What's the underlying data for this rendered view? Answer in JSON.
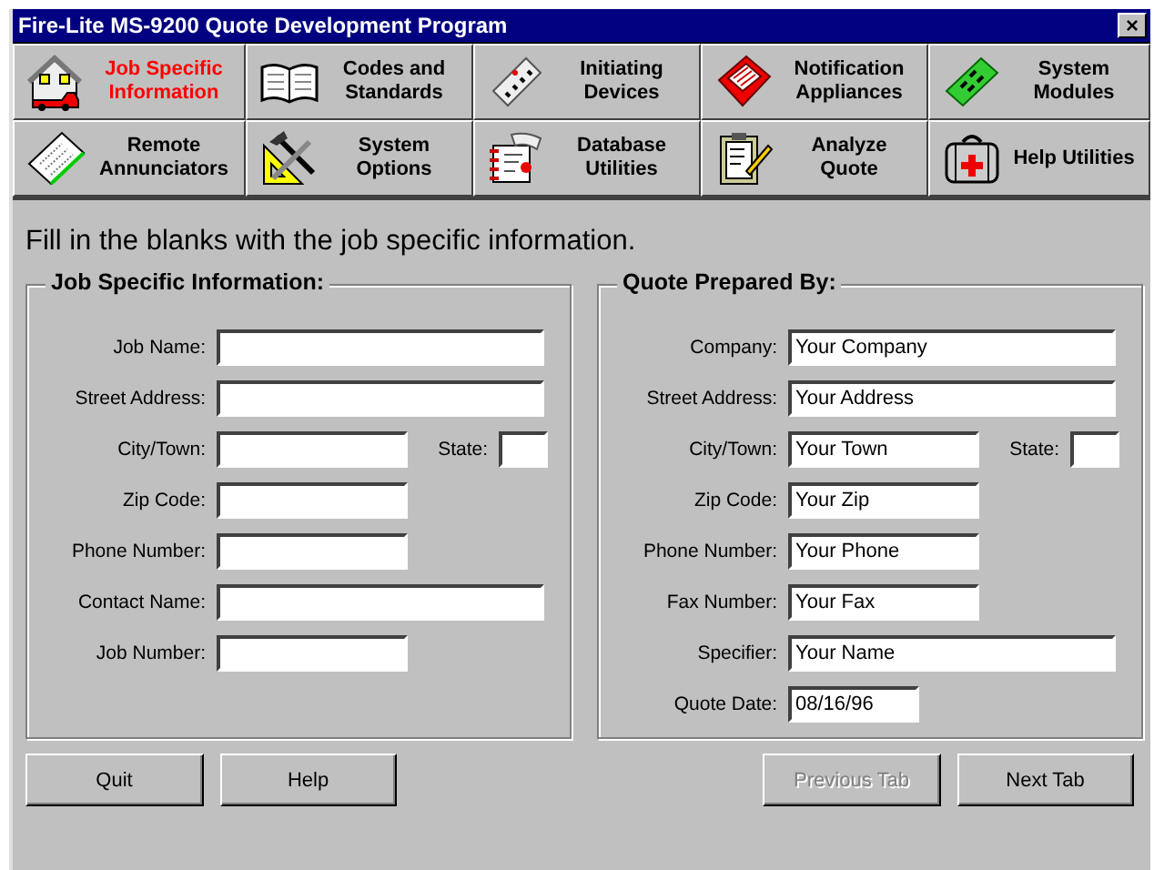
{
  "window": {
    "title": "Fire-Lite MS-9200 Quote Development Program",
    "close": "×"
  },
  "tabs": [
    {
      "label": "Job Specific Information",
      "selected": true
    },
    {
      "label": "Codes and Standards",
      "selected": false
    },
    {
      "label": "Initiating Devices",
      "selected": false
    },
    {
      "label": "Notification Appliances",
      "selected": false
    },
    {
      "label": "System Modules",
      "selected": false
    },
    {
      "label": "Remote Annunciators",
      "selected": false
    },
    {
      "label": "System Options",
      "selected": false
    },
    {
      "label": "Database Utilities",
      "selected": false
    },
    {
      "label": "Analyze Quote",
      "selected": false
    },
    {
      "label": "Help Utilities",
      "selected": false
    }
  ],
  "instruction": "Fill in the blanks with the job specific information.",
  "groups": [
    {
      "title": "Job Specific Information:",
      "rows": [
        [
          {
            "label": "Job Name:",
            "kind": "long"
          }
        ],
        [
          {
            "label": "Street Address:",
            "kind": "long"
          }
        ],
        [
          {
            "label": "City/Town:",
            "kind": "medium"
          },
          {
            "label": "State:",
            "kind": "state"
          }
        ],
        [
          {
            "label": "Zip Code:",
            "kind": "medium"
          }
        ],
        [
          {
            "label": "Phone Number:",
            "kind": "medium"
          }
        ],
        [
          {
            "label": "Contact Name:",
            "kind": "long"
          }
        ],
        [
          {
            "label": "Job Number:",
            "kind": "medium"
          }
        ]
      ]
    },
    {
      "title": "Quote Prepared By:",
      "rows": [
        [
          {
            "label": "Company:",
            "kind": "long",
            "value": "Your Company"
          }
        ],
        [
          {
            "label": "Street Address:",
            "kind": "long",
            "value": "Your Address"
          }
        ],
        [
          {
            "label": "City/Town:",
            "kind": "medium",
            "value": "Your Town"
          },
          {
            "label": "State:",
            "kind": "state"
          }
        ],
        [
          {
            "label": "Zip Code:",
            "kind": "medium",
            "value": "Your Zip"
          }
        ],
        [
          {
            "label": "Phone Number:",
            "kind": "medium",
            "value": "Your Phone"
          }
        ],
        [
          {
            "label": "Fax Number:",
            "kind": "medium",
            "value": "Your Fax"
          }
        ],
        [
          {
            "label": "Specifier:",
            "kind": "long",
            "value": "Your Name"
          }
        ],
        [
          {
            "label": "Quote Date:",
            "kind": "date",
            "value": "08/16/96"
          }
        ]
      ]
    }
  ],
  "buttons": [
    {
      "label": "Quit",
      "disabled": false
    },
    {
      "label": "Help",
      "disabled": false
    },
    {
      "label": "Previous Tab",
      "disabled": true
    },
    {
      "label": "Next Tab",
      "disabled": false
    }
  ]
}
